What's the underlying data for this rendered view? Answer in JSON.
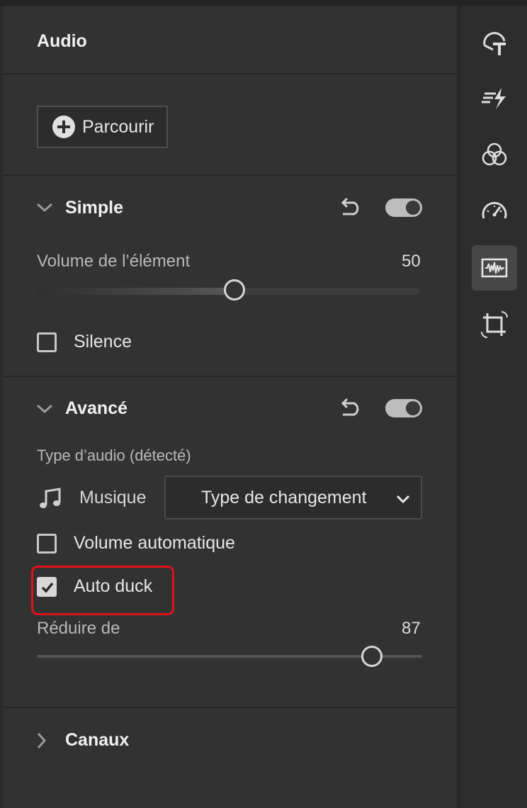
{
  "panel": {
    "title": "Audio",
    "browse_label": "Parcourir"
  },
  "simple": {
    "title": "Simple",
    "enabled": true,
    "volume_label": "Volume de l’élément",
    "volume_value": "50",
    "volume_fraction": 0.5,
    "mute_label": "Silence",
    "mute_checked": false
  },
  "advanced": {
    "title": "Avancé",
    "enabled": true,
    "audio_type_label": "Type d’audio (détecté)",
    "music_label": "Musique",
    "change_type_selected": "Type de changement",
    "auto_volume_label": "Volume automatique",
    "auto_volume_checked": false,
    "auto_duck_label": "Auto duck",
    "auto_duck_checked": true,
    "reduce_label": "Réduire de",
    "reduce_value": "87",
    "reduce_fraction": 0.87
  },
  "channels": {
    "title": "Canaux"
  },
  "rail": {
    "icons": [
      "text-shape-icon",
      "transitions-icon",
      "color-icon",
      "speed-icon",
      "audio-icon",
      "crop-icon"
    ],
    "active": "audio-icon"
  },
  "colors": {
    "panel_bg": "#323232",
    "highlight": "#e0121a"
  }
}
